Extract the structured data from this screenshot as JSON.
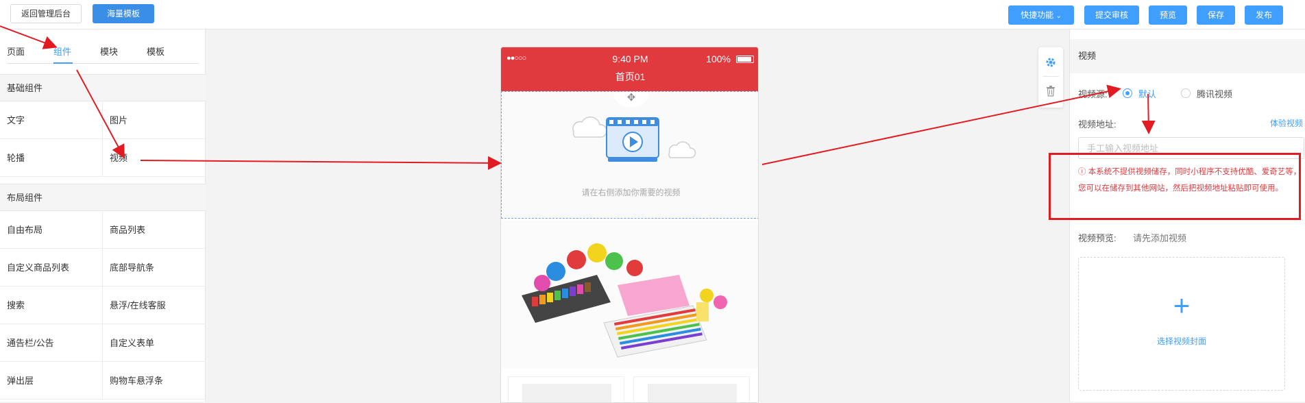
{
  "topbar": {
    "back_label": "返回管理后台",
    "template_label": "海量模板",
    "quick_label": "快捷功能",
    "submit_label": "提交审核",
    "preview_label": "预览",
    "save_label": "保存",
    "publish_label": "发布"
  },
  "left": {
    "tabs": [
      "页面",
      "组件",
      "模块",
      "模板"
    ],
    "group_basic": "基础组件",
    "basic_items": [
      "文字",
      "图片",
      "轮播",
      "视频"
    ],
    "group_layout": "布局组件",
    "layout_items": [
      "自由布局",
      "商品列表",
      "自定义商品列表",
      "底部导航条",
      "搜索",
      "悬浮/在线客服",
      "通告栏/公告",
      "自定义表单",
      "弹出层",
      "购物车悬浮条"
    ]
  },
  "phone": {
    "signal": "●●○○○",
    "time": "9:40 PM",
    "battery": "100%",
    "title": "首页01",
    "video_hint": "请在右侧添加你需要的视频"
  },
  "right": {
    "title": "视频",
    "source_label": "视频源:",
    "source_options": [
      "默认",
      "腾讯视频"
    ],
    "source_selected": "默认",
    "url_label": "视频地址:",
    "try_link": "体验视频",
    "url_placeholder": "手工输入视频地址",
    "warning": "本系统不提供视频储存，同时小程序不支持优酷、爱奇艺等，您可以在储存到其他网站，然后把视频地址粘贴即可使用。",
    "preview_label": "视频预览:",
    "preview_value": "请先添加视频",
    "cover_label": "选择视频封面"
  },
  "colors": {
    "accent": "#409eff",
    "header_red": "#e0393e",
    "annotation_red": "#e21b22"
  },
  "icons": [
    "move-icon",
    "video-icon",
    "cloud-icon",
    "gear-icon",
    "trash-icon",
    "info-icon",
    "plus-icon",
    "chevron-down-icon"
  ]
}
